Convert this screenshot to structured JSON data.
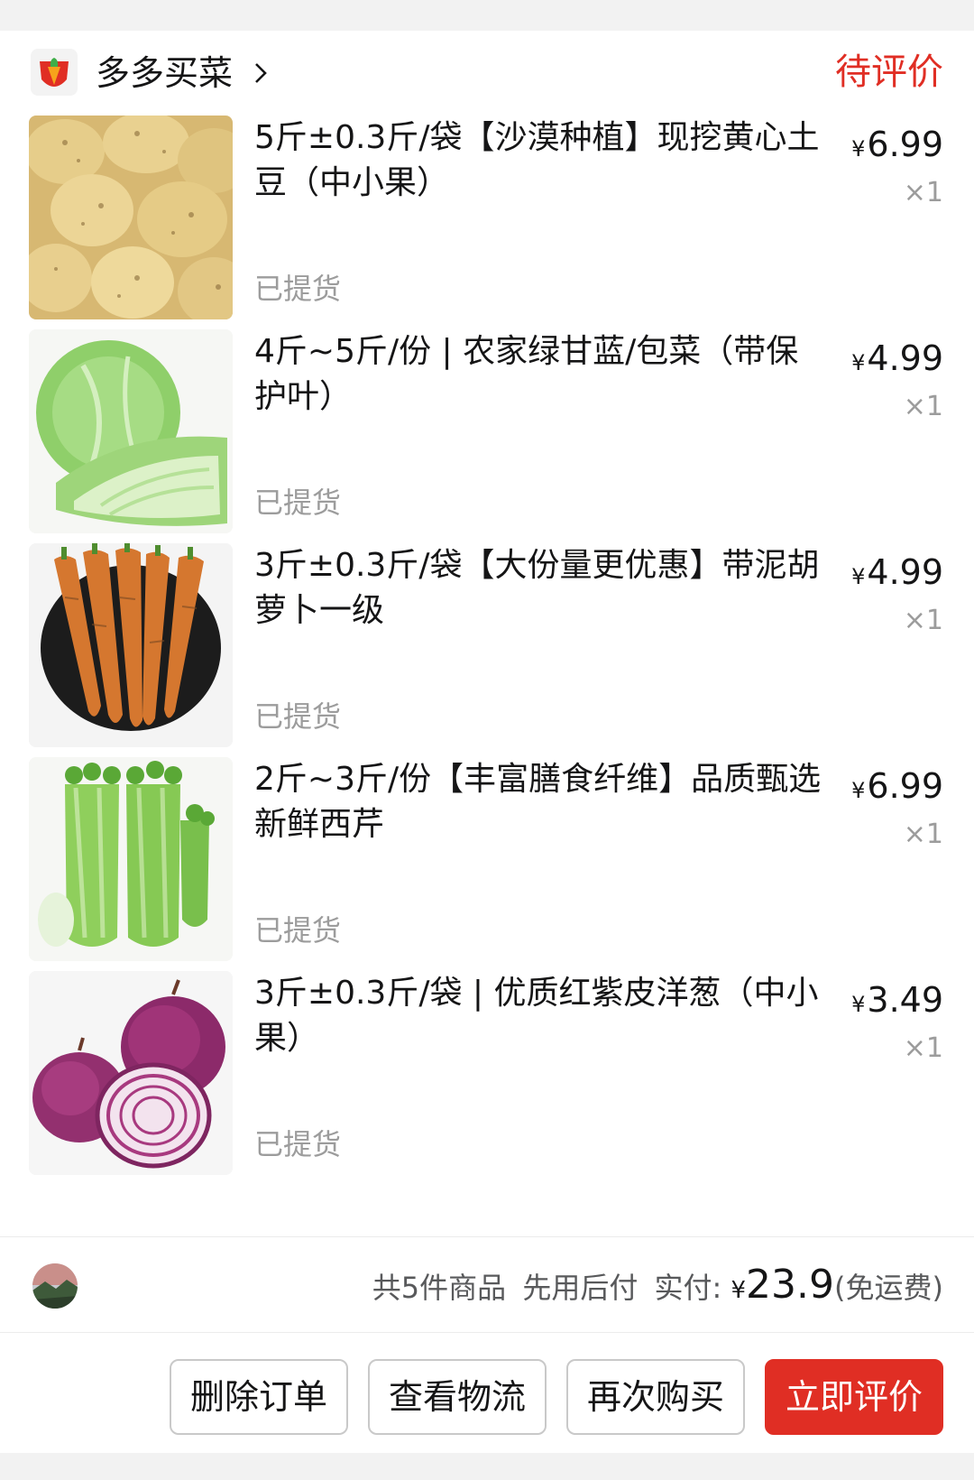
{
  "store": {
    "name": "多多买菜",
    "status": "待评价",
    "logo_color": "#e02e24"
  },
  "items": [
    {
      "title": "5斤±0.3斤/袋【沙漠种植】现挖黄心土豆（中小果）",
      "state": "已提货",
      "currency": "¥",
      "price": "6.99",
      "qty": "×1",
      "image": "potatoes"
    },
    {
      "title": "4斤~5斤/份 | 农家绿甘蓝/包菜（带保护叶）",
      "state": "已提货",
      "currency": "¥",
      "price": "4.99",
      "qty": "×1",
      "image": "cabbage"
    },
    {
      "title": "3斤±0.3斤/袋【大份量更优惠】带泥胡萝卜一级",
      "state": "已提货",
      "currency": "¥",
      "price": "4.99",
      "qty": "×1",
      "image": "carrots"
    },
    {
      "title": "2斤~3斤/份【丰富膳食纤维】品质甄选新鲜西芹",
      "state": "已提货",
      "currency": "¥",
      "price": "6.99",
      "qty": "×1",
      "image": "celery"
    },
    {
      "title": "3斤±0.3斤/袋 | 优质红紫皮洋葱（中小果）",
      "state": "已提货",
      "currency": "¥",
      "price": "3.49",
      "qty": "×1",
      "image": "red-onions"
    }
  ],
  "summary": {
    "count_text": "共5件商品",
    "pay_method": "先用后付",
    "paid_label": "实付:",
    "currency": "¥",
    "total": "23.9",
    "shipping": "(免运费)"
  },
  "actions": {
    "delete": "删除订单",
    "logistics": "查看物流",
    "rebuy": "再次购买",
    "review": "立即评价"
  },
  "colors": {
    "accent": "#e02e24",
    "muted": "#9c9c9c",
    "text": "#151516"
  }
}
